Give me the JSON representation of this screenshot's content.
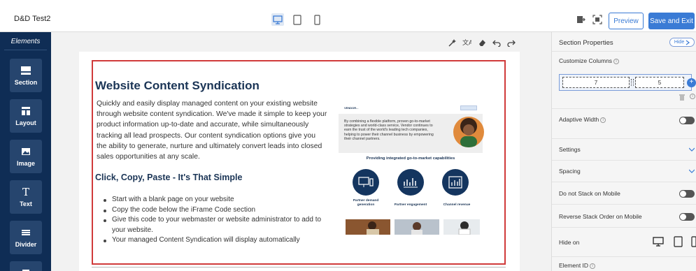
{
  "topbar": {
    "title": "D&D Test2",
    "preview_label": "Preview",
    "save_label": "Save and Exit",
    "accent_color": "#3a7bd5"
  },
  "sidebar": {
    "title": "Elements",
    "items": [
      {
        "label": "Section",
        "icon": "section-icon"
      },
      {
        "label": "Layout",
        "icon": "layout-icon"
      },
      {
        "label": "Image",
        "icon": "image-icon"
      },
      {
        "label": "Text",
        "icon": "text-icon"
      },
      {
        "label": "Divider",
        "icon": "divider-icon"
      }
    ]
  },
  "content": {
    "heading": "Website Content Syndication",
    "intro": "Quickly and easily display managed content on your existing website through website content syndication. We've made it simple to keep your product information up-to-date and accurate, while simultaneously tracking all lead prospects. Our content syndication options give you the ability to generate, nurture and ultimately convert leads into closed sales opportunities at any scale.",
    "subheading": "Click, Copy, Paste - It's That Simple",
    "bullets": [
      "Start with a blank page on your website",
      "Copy the code below the iFrame Code section",
      "Give this code to your webmaster or website administrator to add to your website.",
      "Your managed Content Syndication will display automatically"
    ]
  },
  "preview": {
    "logo": "VENDOR...",
    "hero_text": "By combining a flexible platform, proven go-to-market strategies and world-class service, Vendor continues to earn the trust of the world's leading tech companies, helping to power their channel business by empowering their channel partners.",
    "heading": "Providing integrated go-to-market capabilities",
    "capabilities": [
      "Partner demand generation",
      "Partner engagement",
      "Channel revenue"
    ]
  },
  "panel": {
    "title": "Section Properties",
    "hide_label": "Hide",
    "customize_columns_label": "Customize Columns",
    "col1": "7",
    "col2": "5",
    "adaptive_width_label": "Adaptive Width",
    "settings_label": "Settings",
    "spacing_label": "Spacing",
    "no_stack_label": "Do not Stack on Mobile",
    "reverse_stack_label": "Reverse Stack Order on Mobile",
    "hide_on_label": "Hide on",
    "element_id_label": "Element ID"
  }
}
